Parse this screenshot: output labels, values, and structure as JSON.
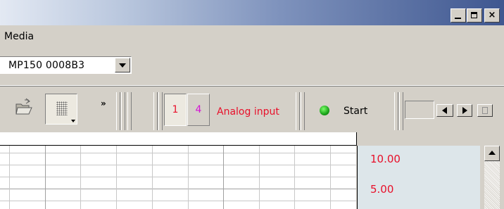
{
  "window": {
    "controls": [
      {
        "name": "minimize",
        "icon": "minimize-icon"
      },
      {
        "name": "maximize",
        "icon": "maximize-icon"
      },
      {
        "name": "close",
        "icon": "close-icon",
        "glyph": "×"
      }
    ]
  },
  "menubar": {
    "items": [
      {
        "label": "Media"
      }
    ]
  },
  "device": {
    "selected": "MP150 0008B3"
  },
  "toolbar": {
    "overflow_glyph": "»",
    "channels": [
      {
        "label": "1",
        "color": "#e8102a",
        "pressed": true
      },
      {
        "label": "4",
        "color": "#d414d4",
        "pressed": false
      }
    ],
    "analog_label": "Analog input",
    "start_label": "Start",
    "status_color": "#1aa21a"
  },
  "graph": {
    "scale_values": [
      "10.00",
      "5.00"
    ],
    "scale_color": "#e8102a",
    "panel_color": "#dde6ea"
  }
}
